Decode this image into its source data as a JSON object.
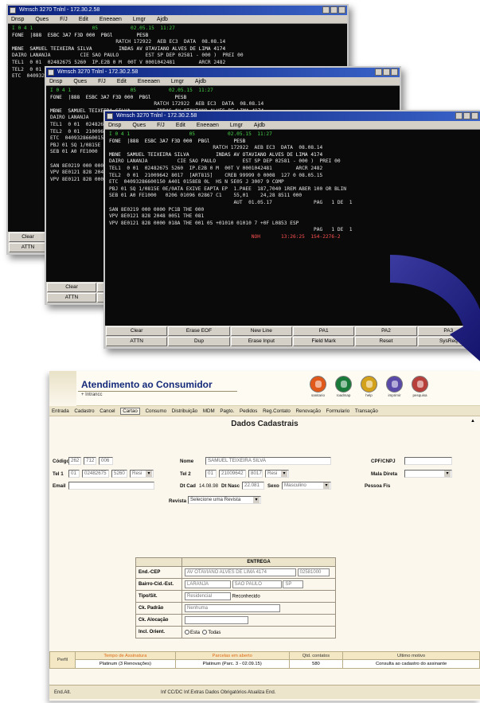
{
  "terminal": {
    "title": "Wrnsch 3270 Tnlnl - 172.30.2.58",
    "menu": [
      "Dnsp",
      "Ques",
      "F/J",
      "Edit",
      "Eneeaen",
      "Lmgr",
      "Ajdb"
    ],
    "lines": [
      "I 0 4 1                    05           02.05.15  11:27",
      "",
      "FONE  |888  ESBC 3A7 F3D 000  PBGl        PESB",
      "                                   RATCH 172922  AEB EC3  DATA  08.08.14",
      "MBNE  SAMUEL TEIXEIRA SILVA         INDAS AV OTAVIANO ALVES DE LIMA 4174",
      "DAIRO LANANJA          CIE SAO PAULO         EST SP DEP 02581 - 000 )  PREI 00",
      "TEL1  0 01  02482675 5260  IP.E2B 0 M  00T V 0001042481        ARCR 2482",
      "TEL2  0 01  21009642 8017  [ART815]    CREB 99999 0 0008  127 0 08.05.15",
      "ETC  04093286600150 A401 0158E8 0L  HS N 5E05 J 3007 9 COMP",
      "",
      "PBJ 01 SQ 1/0815E 0E/0ATA EXIVE EAPTA EP  1.PAEE  187,7040 1REM ABER 100 OR BLIN",
      "SEB 01 A0 FE1000   0206 01096 02867 C1    55,01    24,28 8511 000",
      "",
      "",
      "",
      "",
      "                                          AUT  01.05.17              PAG   1 DE  1",
      "SAN 8E0219 000 0000 PC1B THE 000",
      "VPV 8E0121 828 2048 0051 THE 081",
      "VPV 8E0121 828 0000 018A THE 001 05 +01010 01010 7 +0F L0853 ESP",
      "                                                                     PAG   1 DE  1",
      "",
      "                                                NOH       13:26:25  1S4-2276-2"
    ],
    "keys": [
      "Clear",
      "Erase EOF",
      "New Line",
      "PA1",
      "PA2",
      "PA3",
      "ATTN",
      "Dup",
      "Erase Input",
      "Field Mark",
      "Reset",
      "SysReq"
    ],
    "keys_short": [
      "Clear",
      "ATTN"
    ]
  },
  "web": {
    "app_title": "Atendimento ao Consumidor",
    "app_subtitle": "+ Intrancc",
    "header_icons": [
      {
        "name": "sanitario-icon",
        "caption": "sanitario",
        "color": "#e0581a"
      },
      {
        "name": "roadmap-icon",
        "caption": "roadmap",
        "color": "#1a7a3a"
      },
      {
        "name": "help-icon",
        "caption": "help",
        "color": "#d4a21a"
      },
      {
        "name": "imprimir-icon",
        "caption": "imprimir",
        "color": "#5a4aa8"
      },
      {
        "name": "pesquisa-icon",
        "caption": "pesquisa",
        "color": "#b8403a"
      }
    ],
    "menu": [
      "Entrada",
      "Cadastro",
      "Cancel",
      "Cartao",
      "Consumo",
      "Distribuição",
      "MDM",
      "Pagto.",
      "Pedidos",
      "Reg.Contato",
      "Renovação",
      "Formulario",
      "Transação"
    ],
    "menu_selected": "Cartao",
    "form_title": "Dados Cadastrais",
    "codigo_label": "Código",
    "codigo_values": [
      "262",
      "712",
      "006"
    ],
    "tel1_label": "Tel 1",
    "tel1_values": [
      "01",
      "02482675",
      "5260",
      "Resi"
    ],
    "email_label": "Email",
    "nome_label": "Nome",
    "nome_value": "SAMUEL TEIXEIRA SILVA",
    "tel2_label": "Tel 2",
    "tel2_values": [
      "01",
      "21009642",
      "8017",
      "Resi"
    ],
    "dtcad_label": "Dt Cad",
    "dtcad_value": "14.08.98",
    "dtnasc_label": "Dt Nasc",
    "dtnasc_value": "22.081",
    "sexo_label": "Sexo",
    "sexo_value": "Masculino",
    "revista_label": "Revista",
    "revista_value": "Selecione uma Revista",
    "cpf_label": "CPF/CNPJ",
    "mala_label": "Mala Direta",
    "pessoa_label": "Pessoa Fis",
    "entrega": {
      "header": "ENTREGA",
      "end_label": "End.-CEP",
      "end_value": "AV OTAVIANO ALVES DE LIMA 4174",
      "cep_value": "02581000",
      "bairro_label": "Bairro-Cid.-Est.",
      "bairro_value": "LARANJA",
      "cidade_value": "SAO PAULO",
      "estado_value": "SP",
      "tipo_label": "Tipo/Sit.",
      "tipo_value": "Residencial",
      "sit_value": "Reconhecido",
      "padrao_label": "Ck. Padrão",
      "padrao_value": "Nenhuma",
      "auto_label": "Ck. Alocação",
      "incl_label": "Incl. Orient.",
      "incl_opt1": "Esta",
      "incl_opt2": "Todas"
    },
    "bottom_table": {
      "col_perfil": "Perfil",
      "headers": [
        "Tempo de Assinatura",
        "Parcelas em aberto",
        "Qtd. contatos",
        "Ultimo motivo"
      ],
      "row": [
        "Platinum (3 Renovações)",
        "Platinum (Parc. 3 - 02.09.15)",
        "580",
        "Consulta ao cadastro do assinante"
      ]
    },
    "status_left": "End.Alt.",
    "status_right": "Inf CC/DC   Inf.Extras   Dados Obrigatórios   Atualiza End."
  }
}
